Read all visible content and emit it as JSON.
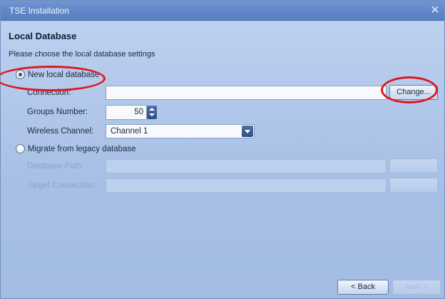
{
  "window": {
    "title": "TSE Installation",
    "close_glyph": "✕"
  },
  "page": {
    "heading": "Local Database",
    "subheading": "Please choose the local database settings"
  },
  "options": {
    "new_local": {
      "label": "New local database",
      "selected": true,
      "connection_label": "Connection:",
      "connection_value": "",
      "change_button": "Change...",
      "groups_label": "Groups Number:",
      "groups_value": "50",
      "channel_label": "Wireless Channel:",
      "channel_value": "Channel 1"
    },
    "migrate": {
      "label": "Migrate from legacy database",
      "selected": false,
      "db_path_label": "Database Path:",
      "target_conn_label": "Target Connection:"
    }
  },
  "footer": {
    "back_button": "< Back",
    "next_button": "Next >"
  },
  "annotation_color": "#e1161b"
}
